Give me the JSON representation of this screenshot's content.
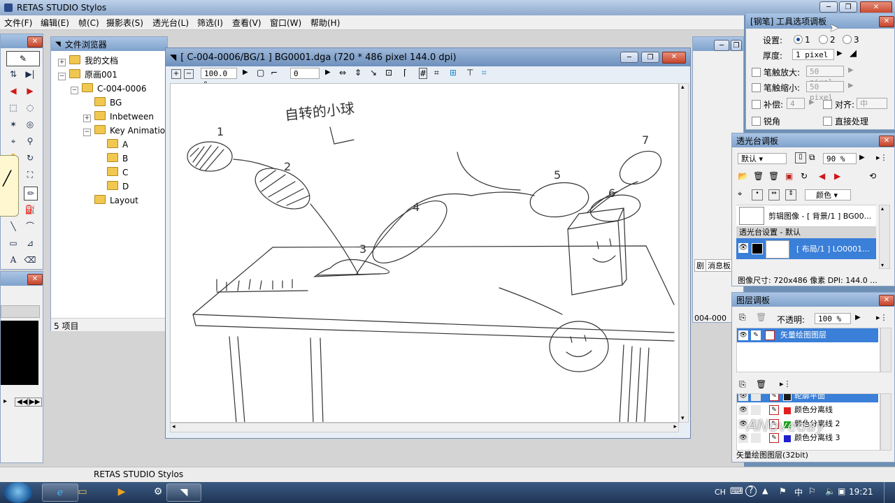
{
  "app": {
    "title": "RETAS STUDIO Stylos",
    "menu": [
      "文件(F)",
      "编辑(E)",
      "帧(C)",
      "摄影表(S)",
      "透光台(L)",
      "筛选(I)",
      "查看(V)",
      "窗口(W)",
      "帮助(H)"
    ],
    "status_text": "RETAS STUDIO Stylos"
  },
  "file_browser": {
    "title": "文件浏览器",
    "tree": [
      {
        "label": "我的文档",
        "depth": 0,
        "expander": "+"
      },
      {
        "label": "原画001",
        "depth": 0,
        "expander": "−"
      },
      {
        "label": "C-004-0006",
        "depth": 1,
        "expander": "−"
      },
      {
        "label": "BG",
        "depth": 2,
        "expander": ""
      },
      {
        "label": "Inbetween",
        "depth": 2,
        "expander": "+"
      },
      {
        "label": "Key Animation",
        "depth": 2,
        "expander": "−"
      },
      {
        "label": "A",
        "depth": 3,
        "expander": ""
      },
      {
        "label": "B",
        "depth": 3,
        "expander": ""
      },
      {
        "label": "C",
        "depth": 3,
        "expander": ""
      },
      {
        "label": "D",
        "depth": 3,
        "expander": ""
      },
      {
        "label": "Layout",
        "depth": 2,
        "expander": ""
      }
    ],
    "status": "5 项目",
    "behind_tabs": [
      "剧",
      "消息板"
    ],
    "behind_text": "004-000"
  },
  "canvas_window": {
    "title": "[ C-004-0006/BG/1 ] BG0001.dga (720 * 486 pixel 144.0 dpi)",
    "zoom": "100.0 %",
    "rotation": "0",
    "sketch_text": "自转的小球",
    "numbers": [
      "1",
      "2",
      "3",
      "4",
      "5",
      "6",
      "7"
    ]
  },
  "pen_options": {
    "title": "[钢笔] 工具选项调板",
    "setting_label": "设置:",
    "settings": [
      "1",
      "2",
      "3"
    ],
    "selected_setting": "1",
    "thickness_label": "厚度:",
    "thickness_value": "1 pixel",
    "zoom_in_label": "笔触放大:",
    "zoom_in_value": "50 pixel",
    "zoom_out_label": "笔触缩小:",
    "zoom_out_value": "50 pixel",
    "compensate_label": "补偿:",
    "compensate_value": "4",
    "align_label": "对齐:",
    "align_value": "中",
    "sharp_label": "锐角",
    "direct_label": "直接处理"
  },
  "lightbox": {
    "title": "透光台调板",
    "mode": "默认",
    "opacity": "90 %",
    "color_label": "颜色",
    "clip_row": "剪辑图像 - [ 背景/1 ] BG00...",
    "settings_header": "透光台设置 - 默认",
    "selected_row": "[ 布局/1 ] LO0001...",
    "info": "图像尺寸: 720x486 像素    DPI: 144.0 ..."
  },
  "layers": {
    "title": "图层调板",
    "opacity_label": "不透明:",
    "opacity_value": "100 %",
    "vector_layer": "矢量绘图图层",
    "sub_layers": [
      {
        "name": "轮廓平面",
        "color": "#1a1a1a"
      },
      {
        "name": "颜色分离线",
        "color": "#e02020"
      },
      {
        "name": "颜色分离线 2",
        "color": "#20b020"
      },
      {
        "name": "颜色分离线 3",
        "color": "#2020d0"
      }
    ],
    "footer": "矢量绘图图层(32bit)"
  },
  "watermark": "ANoveday",
  "taskbar": {
    "lang": "CH",
    "clock": "19:21"
  },
  "colors": {
    "selection": "#3a7fd8",
    "desktop": "#6e8fb4",
    "titlebar": "#9fbbdf"
  }
}
